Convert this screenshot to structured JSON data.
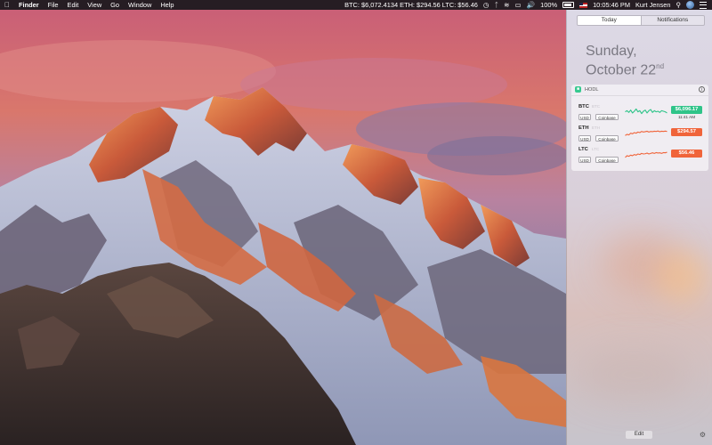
{
  "menubar": {
    "apple_icon": "apple-logo-icon",
    "app_name": "Finder",
    "menus": [
      "File",
      "Edit",
      "View",
      "Go",
      "Window",
      "Help"
    ],
    "ticker": "BTC: $6,072.4134 ETH: $294.56 LTC: $56.46",
    "battery_percent": "100%",
    "clock": "10:05:46 PM",
    "user_name": "Kurt Jensen"
  },
  "notification_center": {
    "tabs": [
      {
        "label": "Today",
        "active": true
      },
      {
        "label": "Notifications",
        "active": false
      }
    ],
    "date_day": "Sunday,",
    "date_month_day": "October 22",
    "date_suffix": "nd",
    "edit_label": "Edit",
    "widget": {
      "title": "HODL",
      "app_icon": "hodl-app-icon",
      "info_icon": "info-icon",
      "rows": [
        {
          "symbol": "BTC",
          "currency": "USD",
          "exchange": "Coinbase",
          "price": "$6,096.17",
          "updated": "11:41 AM",
          "trend_color": "#2fc489",
          "badge_color": "#2fc489",
          "sparkline": [
            0.45,
            0.55,
            0.4,
            0.6,
            0.35,
            0.5,
            0.7,
            0.45,
            0.55,
            0.3,
            0.5,
            0.6,
            0.35,
            0.55,
            0.65,
            0.4,
            0.55,
            0.45,
            0.5,
            0.4,
            0.55,
            0.5,
            0.45,
            0.35
          ]
        },
        {
          "symbol": "ETH",
          "currency": "USD",
          "exchange": "Coinbase",
          "price": "$294.57",
          "trend_color": "#f0643a",
          "badge_color": "#f0643a",
          "sparkline": [
            0.25,
            0.35,
            0.3,
            0.45,
            0.4,
            0.5,
            0.45,
            0.55,
            0.5,
            0.6,
            0.55,
            0.58,
            0.62,
            0.55,
            0.6,
            0.58,
            0.62,
            0.6,
            0.64,
            0.58,
            0.62,
            0.6,
            0.63,
            0.6
          ]
        },
        {
          "symbol": "LTC",
          "currency": "USD",
          "exchange": "Coinbase",
          "price": "$56.46",
          "trend_color": "#f0643a",
          "badge_color": "#f0643a",
          "sparkline": [
            0.2,
            0.35,
            0.3,
            0.4,
            0.35,
            0.45,
            0.4,
            0.5,
            0.45,
            0.55,
            0.5,
            0.52,
            0.58,
            0.5,
            0.55,
            0.6,
            0.55,
            0.62,
            0.58,
            0.6,
            0.55,
            0.62,
            0.6,
            0.65
          ]
        }
      ]
    }
  },
  "colors": {
    "accent_green": "#2fc489",
    "accent_red": "#f0643a",
    "menubar_bg": "#18181c"
  }
}
